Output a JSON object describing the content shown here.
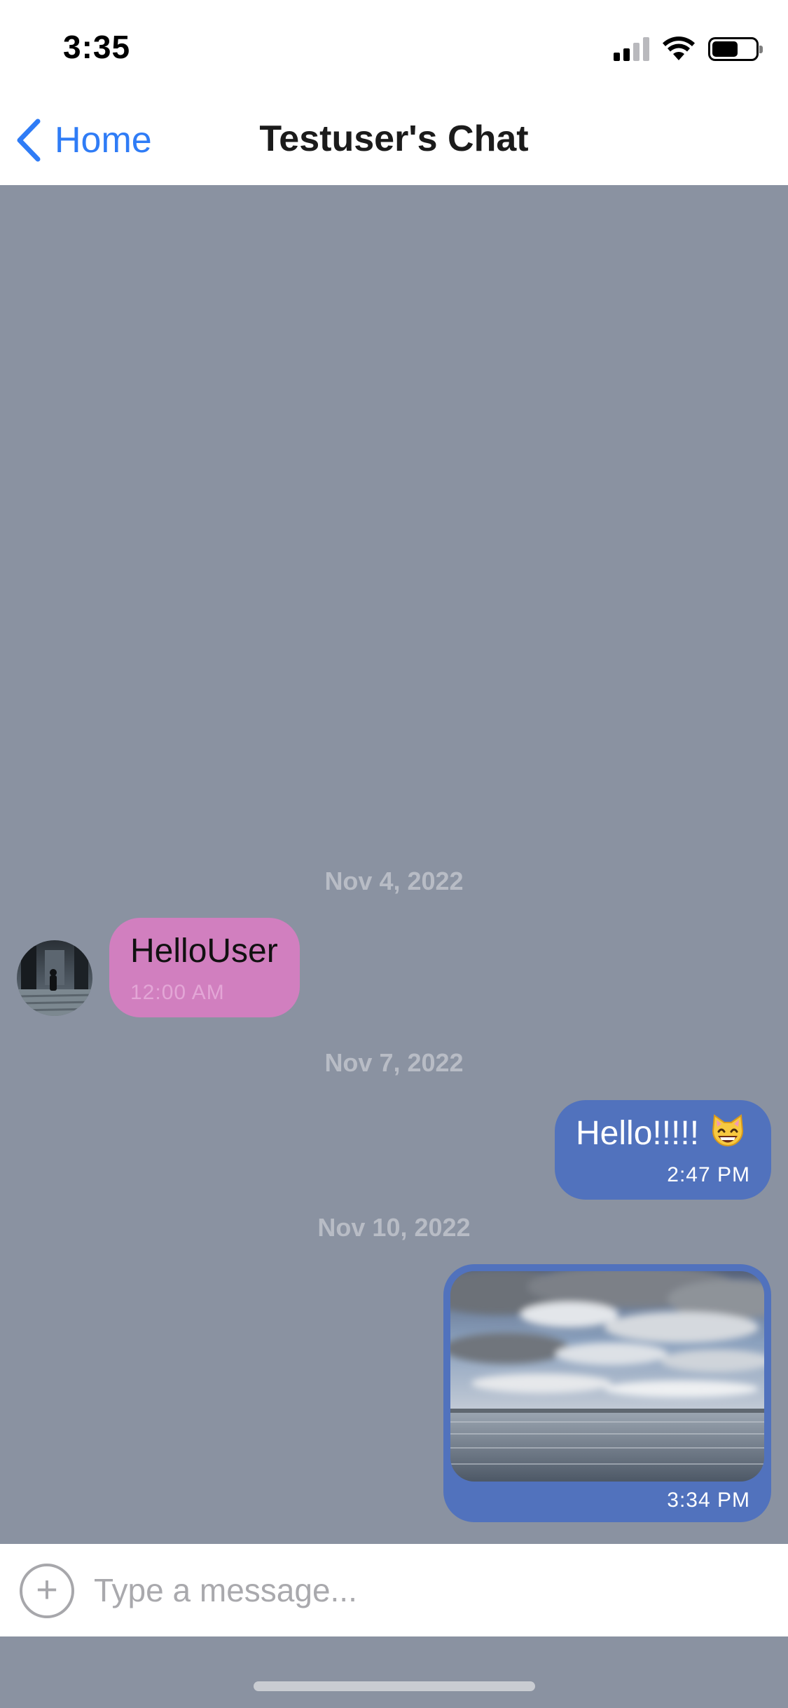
{
  "status_bar": {
    "time": "3:35",
    "battery_level": 0.6
  },
  "nav": {
    "back_label": "Home",
    "title": "Testuser's Chat"
  },
  "messages": [
    {
      "date": "Nov 4, 2022",
      "direction": "incoming",
      "text": "HelloUser",
      "time": "12:00 AM"
    },
    {
      "date": "Nov 7, 2022",
      "direction": "outgoing",
      "text": "Hello!!!!!",
      "emoji": "grinning-cat-face",
      "time": "2:47 PM"
    },
    {
      "date": "Nov 10, 2022",
      "direction": "outgoing",
      "image": "sea-and-cloudy-sky-photo",
      "time": "3:34 PM"
    }
  ],
  "input": {
    "placeholder": "Type a message...",
    "value": ""
  },
  "colors": {
    "background": "#8a92a1",
    "accent": "#2f7cf6",
    "incoming_bubble": "#d17fbf",
    "outgoing_bubble": "#5172bd"
  }
}
